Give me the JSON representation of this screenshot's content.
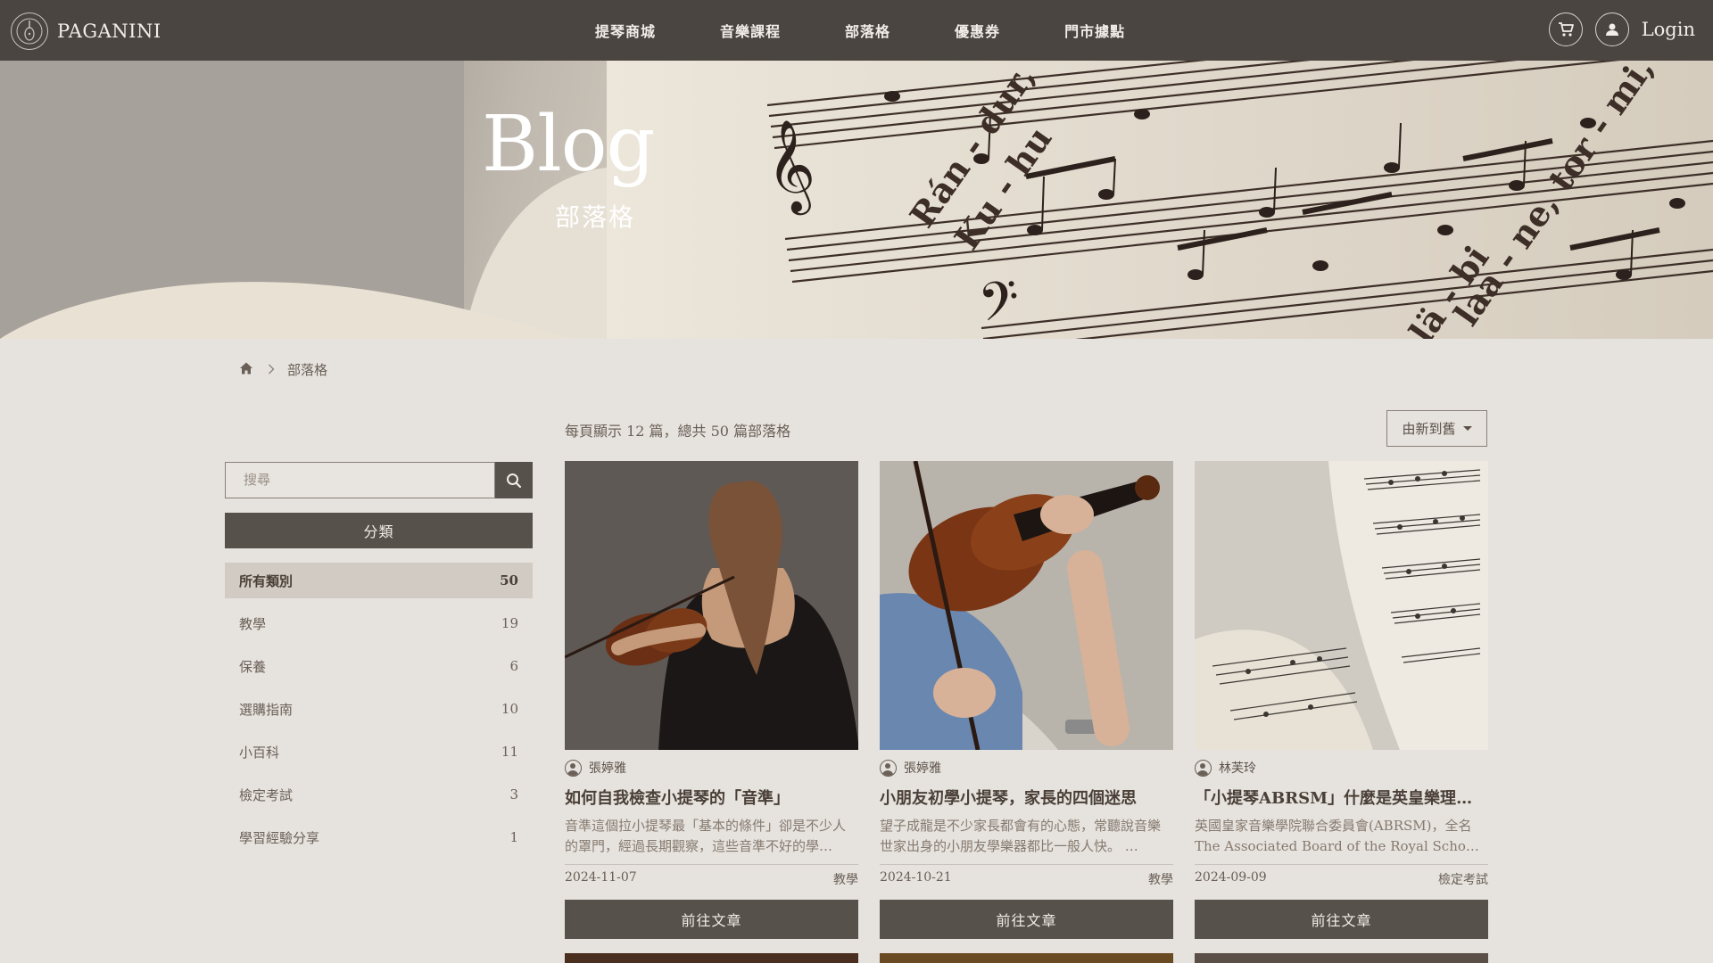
{
  "nav": {
    "brand": "PAGANINI",
    "menu": [
      "提琴商城",
      "音樂課程",
      "部落格",
      "優惠券",
      "門市據點"
    ],
    "login": "Login"
  },
  "hero": {
    "title": "Blog",
    "subtitle": "部落格"
  },
  "breadcrumb": {
    "current": "部落格"
  },
  "sidebar": {
    "search_placeholder": "搜尋",
    "category_header": "分類",
    "categories": [
      {
        "label": "所有類別",
        "count": "50"
      },
      {
        "label": "教學",
        "count": "19"
      },
      {
        "label": "保養",
        "count": "6"
      },
      {
        "label": "選購指南",
        "count": "10"
      },
      {
        "label": "小百科",
        "count": "11"
      },
      {
        "label": "檢定考試",
        "count": "3"
      },
      {
        "label": "學習經驗分享",
        "count": "1"
      }
    ]
  },
  "main": {
    "summary": "每頁顯示 12 篇，總共 50 篇部落格",
    "sort_label": "由新到舊",
    "posts": [
      {
        "author": "張婷雅",
        "title": "如何自我檢查小提琴的「音準」",
        "excerpt": "音準這個拉小提琴最「基本的條件」卻是不少人的罩門，經過長期觀察，這些音準不好的學…",
        "date": "2024-11-07",
        "category": "教學",
        "button": "前往文章"
      },
      {
        "author": "張婷雅",
        "title": "小朋友初學小提琴，家長的四個迷思",
        "excerpt": "望子成龍是不少家長都會有的心態，常聽說音樂世家出身的小朋友學樂器都比一般人快。 …",
        "date": "2024-10-21",
        "category": "教學",
        "button": "前往文章"
      },
      {
        "author": "林芙玲",
        "title": "「小提琴ABRSM」什麼是英皇樂理考…",
        "excerpt": "英國皇家音樂學院聯合委員會(ABRSM)，全名The Associated Board of the Royal Scho…",
        "date": "2024-09-09",
        "category": "檢定考試",
        "button": "前往文章"
      }
    ]
  },
  "icons": {
    "logo": "paganini-logo-icon",
    "cart": "cart-icon",
    "user": "user-icon",
    "home": "home-icon",
    "search": "search-icon",
    "chevron": "chevron-right-icon"
  },
  "colors": {
    "nav_bg": "#4a4540",
    "page_bg": "#e6e2dd",
    "button_bg": "#57514b",
    "active_category_bg": "#d1cbc4"
  }
}
